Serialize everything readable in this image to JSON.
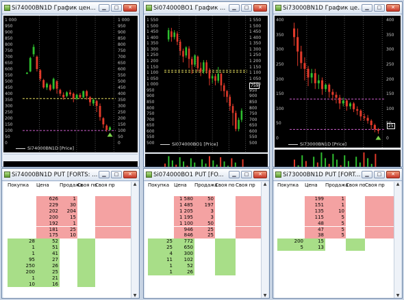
{
  "colors": {
    "sell": "#f4a2a2",
    "buy": "#a8de88",
    "bull": "#2fbf2f",
    "bear": "#e23a2a"
  },
  "windows": {
    "chart1": {
      "title": "Si74000BN1D График цен...",
      "legend": "Si74000BN1D [Price]",
      "ticks": [
        "1 000",
        "950",
        "900",
        "850",
        "800",
        "750",
        "700",
        "650",
        "600",
        "550",
        "500",
        "450",
        "400",
        "350",
        "300",
        "250",
        "200",
        "150",
        "100",
        "50",
        "0"
      ]
    },
    "chart2": {
      "title": "Si074000BO1 График ...",
      "legend": "Si074000BO1 [Price]",
      "price_tag": "759",
      "ticks": [
        "1 550",
        "1 500",
        "1 450",
        "1 400",
        "1 350",
        "1 300",
        "1 250",
        "1 200",
        "1 150",
        "1 100",
        "1 050",
        "1 000",
        "950",
        "900",
        "850",
        "800",
        "750",
        "700",
        "650",
        "600",
        "550",
        "500"
      ]
    },
    "chart3": {
      "title": "Si73000BN1D График це...",
      "legend": "Si73000BN1D [Price]",
      "price_tag": "25",
      "ticks": [
        "400",
        "350",
        "300",
        "250",
        "200",
        "150",
        "100",
        "50",
        "0"
      ]
    },
    "book1": {
      "title": "Si74000BN1D PUT [FORTS: ..."
    },
    "book2": {
      "title": "Si074000BO1 PUT [FO..."
    },
    "book3": {
      "title": "Si73000BN1D PUT [FORT..."
    }
  },
  "orderbook_headers": [
    "Покупка",
    "Цена",
    "Продажа",
    "Своя по",
    "Своя пр"
  ],
  "books": {
    "book1": {
      "sell": [
        [
          "626",
          "1"
        ],
        [
          "229",
          "30"
        ],
        [
          "202",
          "204"
        ],
        [
          "200",
          "15"
        ],
        [
          "192",
          "1"
        ],
        [
          "181",
          "25"
        ],
        [
          "175",
          "10"
        ]
      ],
      "buy": [
        [
          "28",
          "52"
        ],
        [
          "1",
          "51"
        ],
        [
          "1",
          "41"
        ],
        [
          "95",
          "27"
        ],
        [
          "250",
          "26"
        ],
        [
          "200",
          "25"
        ],
        [
          "1",
          "21"
        ],
        [
          "10",
          "16"
        ]
      ]
    },
    "book2": {
      "sell": [
        [
          "1 580",
          "50"
        ],
        [
          "1 485",
          "197"
        ],
        [
          "1 205",
          "3"
        ],
        [
          "1 195",
          "3"
        ],
        [
          "1 100",
          "50"
        ],
        [
          "946",
          "25"
        ],
        [
          "846",
          "25"
        ]
      ],
      "buy": [
        [
          "25",
          "772"
        ],
        [
          "25",
          "650"
        ],
        [
          "4",
          "300"
        ],
        [
          "11",
          "102"
        ],
        [
          "1",
          "52"
        ],
        [
          "1",
          "26"
        ]
      ]
    },
    "book3": {
      "sell": [
        [
          "199",
          "1"
        ],
        [
          "151",
          "1"
        ],
        [
          "135",
          "10"
        ],
        [
          "115",
          "5"
        ],
        [
          "48",
          "5"
        ],
        [
          "47",
          "5"
        ],
        [
          "38",
          "5"
        ]
      ],
      "buy": [
        [
          "200",
          "15"
        ],
        [
          "5",
          "13"
        ]
      ]
    }
  },
  "charts": {
    "chart1": {
      "candles": [
        [
          560,
          570,
          560,
          575
        ],
        [
          580,
          690,
          575,
          700
        ],
        [
          720,
          780,
          700,
          800
        ],
        [
          700,
          600,
          580,
          710
        ],
        [
          590,
          520,
          500,
          600
        ],
        [
          510,
          450,
          440,
          520
        ],
        [
          450,
          480,
          430,
          490
        ],
        [
          470,
          430,
          420,
          480
        ],
        [
          440,
          520,
          430,
          530
        ],
        [
          500,
          440,
          400,
          510
        ],
        [
          430,
          400,
          380,
          440
        ],
        [
          390,
          370,
          350,
          410
        ],
        [
          380,
          410,
          370,
          420
        ],
        [
          410,
          395,
          380,
          430
        ],
        [
          400,
          360,
          330,
          410
        ],
        [
          360,
          390,
          350,
          400
        ],
        [
          390,
          370,
          360,
          405
        ],
        [
          370,
          420,
          360,
          425
        ],
        [
          420,
          380,
          350,
          430
        ],
        [
          370,
          330,
          300,
          380
        ],
        [
          320,
          350,
          300,
          360
        ],
        [
          340,
          300,
          250,
          350
        ],
        [
          300,
          210,
          180,
          320
        ],
        [
          200,
          150,
          120,
          210
        ],
        [
          140,
          105,
          90,
          150
        ],
        [
          105,
          125,
          100,
          135
        ]
      ],
      "ymin": 0,
      "ymax": 1000
    },
    "chart2": {
      "candles": [
        [
          1400,
          1480,
          1380,
          1500
        ],
        [
          1470,
          1420,
          1380,
          1500
        ],
        [
          1420,
          1460,
          1400,
          1480
        ],
        [
          1450,
          1380,
          1350,
          1470
        ],
        [
          1380,
          1300,
          1260,
          1400
        ],
        [
          1300,
          1250,
          1200,
          1320
        ],
        [
          1260,
          1330,
          1240,
          1340
        ],
        [
          1320,
          1230,
          1150,
          1340
        ],
        [
          1230,
          1180,
          1100,
          1250
        ],
        [
          1180,
          1260,
          1160,
          1270
        ],
        [
          1250,
          1150,
          1120,
          1260
        ],
        [
          1150,
          1120,
          1080,
          1200
        ],
        [
          1120,
          1200,
          1100,
          1220
        ],
        [
          1200,
          1130,
          1100,
          1220
        ],
        [
          1130,
          1060,
          1000,
          1150
        ],
        [
          1060,
          1080,
          1020,
          1100
        ],
        [
          1080,
          1040,
          1000,
          1100
        ],
        [
          1040,
          1100,
          1020,
          1160
        ],
        [
          1100,
          1000,
          950,
          1110
        ],
        [
          1000,
          950,
          900,
          1020
        ],
        [
          950,
          900,
          850,
          960
        ],
        [
          900,
          820,
          780,
          920
        ],
        [
          820,
          760,
          650,
          840
        ],
        [
          760,
          620,
          600,
          780
        ],
        [
          620,
          700,
          600,
          720
        ],
        [
          700,
          780,
          680,
          800
        ]
      ],
      "ymin": 500,
      "ymax": 1570
    },
    "chart3": {
      "candles": [
        [
          380,
          350,
          320,
          400
        ],
        [
          350,
          300,
          250,
          380
        ],
        [
          300,
          260,
          240,
          320
        ],
        [
          260,
          240,
          200,
          280
        ],
        [
          240,
          210,
          180,
          250
        ],
        [
          210,
          225,
          190,
          240
        ],
        [
          225,
          190,
          170,
          240
        ],
        [
          190,
          200,
          170,
          220
        ],
        [
          200,
          170,
          150,
          210
        ],
        [
          170,
          185,
          160,
          190
        ],
        [
          185,
          160,
          140,
          190
        ],
        [
          160,
          150,
          130,
          170
        ],
        [
          150,
          140,
          120,
          160
        ],
        [
          140,
          120,
          100,
          150
        ],
        [
          120,
          130,
          110,
          140
        ],
        [
          130,
          110,
          95,
          135
        ],
        [
          110,
          120,
          100,
          125
        ],
        [
          120,
          100,
          90,
          125
        ],
        [
          100,
          95,
          80,
          110
        ],
        [
          95,
          75,
          60,
          100
        ],
        [
          75,
          70,
          60,
          85
        ],
        [
          70,
          60,
          50,
          80
        ],
        [
          60,
          45,
          30,
          65
        ],
        [
          45,
          30,
          20,
          50
        ],
        [
          30,
          25,
          15,
          35
        ]
      ],
      "ymin": 0,
      "ymax": 410
    }
  }
}
